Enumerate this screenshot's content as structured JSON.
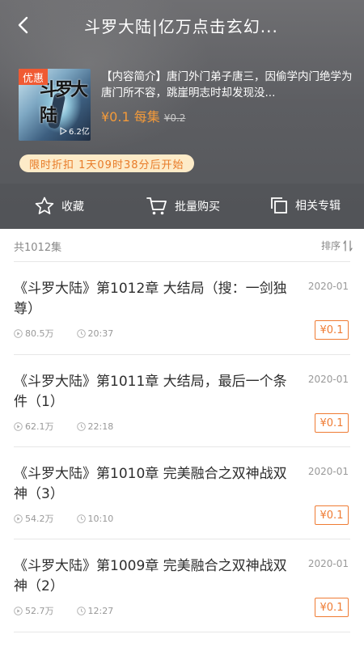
{
  "header": {
    "title": "斗罗大陆|亿万点击玄幻...",
    "back_icon": "chevron-left-icon"
  },
  "album": {
    "cover_badge": "优惠",
    "cover_title": "斗罗大陆",
    "play_count": "6.2亿",
    "description": "【内容简介】唐门外门弟子唐三，因偷学内门绝学为唐门所不容，跳崖明志时却发现没...",
    "price": "¥0.1 每集",
    "original_price": "¥0.2",
    "promo": "限时折扣 1天09时38分后开始"
  },
  "actions": {
    "favorite": "收藏",
    "batch_buy": "批量购买",
    "related": "相关专辑"
  },
  "list": {
    "count": "共1012集",
    "sort": "排序",
    "episodes": [
      {
        "title": "《斗罗大陆》第1012章 大结局（搜：一剑独尊）",
        "date": "2020-01",
        "plays": "80.5万",
        "duration": "20:37",
        "price": "¥0.1"
      },
      {
        "title": "《斗罗大陆》第1011章 大结局，最后一个条件（1）",
        "date": "2020-01",
        "plays": "62.1万",
        "duration": "22:18",
        "price": "¥0.1"
      },
      {
        "title": "《斗罗大陆》第1010章 完美融合之双神战双神（3）",
        "date": "2020-01",
        "plays": "54.2万",
        "duration": "10:10",
        "price": "¥0.1"
      },
      {
        "title": "《斗罗大陆》第1009章 完美融合之双神战双神（2）",
        "date": "2020-01",
        "plays": "52.7万",
        "duration": "12:27",
        "price": "¥0.1"
      }
    ]
  },
  "colors": {
    "accent": "#ef7b33",
    "promo_bg": "#fdebc8",
    "header_bg": "#5d5e62"
  }
}
